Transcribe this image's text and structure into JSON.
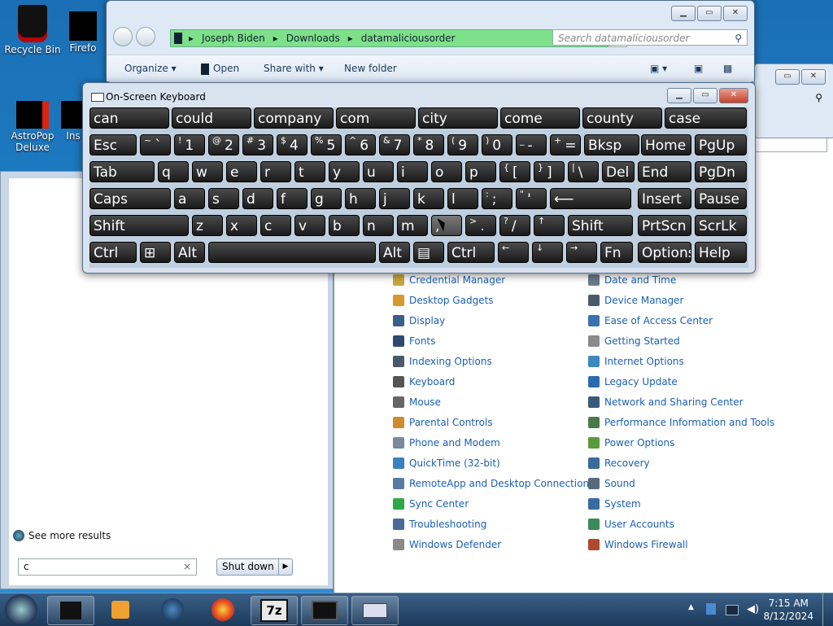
{
  "desktop": {
    "icons": [
      {
        "label": "Recycle Bin"
      },
      {
        "label": "Firefo"
      },
      {
        "label": "AstroPop Deluxe"
      },
      {
        "label": "Ins"
      }
    ]
  },
  "explorer": {
    "breadcrumb": [
      "Joseph Biden",
      "Downloads",
      "datamaliciousorder"
    ],
    "search_placeholder": "Search datamaliciousorder",
    "toolbar": {
      "organize": "Organize",
      "open": "Open",
      "share_with": "Share with",
      "new_folder": "New folder"
    }
  },
  "osk": {
    "title": "On-Screen Keyboard",
    "predictions": [
      "can",
      "could",
      "company",
      "com",
      "city",
      "come",
      "county",
      "case"
    ],
    "row1": [
      {
        "main": "Esc"
      },
      {
        "main": "` ",
        "sup": "~"
      },
      {
        "main": "1",
        "sup": "!"
      },
      {
        "main": "2",
        "sup": "@"
      },
      {
        "main": "3",
        "sup": "#"
      },
      {
        "main": "4",
        "sup": "$"
      },
      {
        "main": "5",
        "sup": "%"
      },
      {
        "main": "6",
        "sup": "^"
      },
      {
        "main": "7",
        "sup": "&"
      },
      {
        "main": "8",
        "sup": "*"
      },
      {
        "main": "9",
        "sup": "("
      },
      {
        "main": "0",
        "sup": ")"
      },
      {
        "main": "-",
        "sup": "_"
      },
      {
        "main": "=",
        "sup": "+"
      },
      {
        "main": "Bksp"
      },
      {
        "main": "Home"
      },
      {
        "main": "PgUp"
      }
    ],
    "row2": [
      {
        "main": "Tab"
      },
      {
        "main": "q"
      },
      {
        "main": "w"
      },
      {
        "main": "e"
      },
      {
        "main": "r"
      },
      {
        "main": "t"
      },
      {
        "main": "y"
      },
      {
        "main": "u"
      },
      {
        "main": "i"
      },
      {
        "main": "o"
      },
      {
        "main": "p"
      },
      {
        "main": "[",
        "sup": "{"
      },
      {
        "main": "]",
        "sup": "}"
      },
      {
        "main": "\\",
        "sup": "|"
      },
      {
        "main": "Del"
      },
      {
        "main": "End"
      },
      {
        "main": "PgDn"
      }
    ],
    "row3": [
      {
        "main": "Caps"
      },
      {
        "main": "a"
      },
      {
        "main": "s"
      },
      {
        "main": "d"
      },
      {
        "main": "f"
      },
      {
        "main": "g"
      },
      {
        "main": "h"
      },
      {
        "main": "j"
      },
      {
        "main": "k"
      },
      {
        "main": "l"
      },
      {
        "main": ";",
        "sup": ":"
      },
      {
        "main": "'",
        "sup": "\""
      },
      {
        "main": "⟵"
      },
      {
        "main": "Insert"
      },
      {
        "main": "Pause"
      }
    ],
    "row4": [
      {
        "main": "Shift"
      },
      {
        "main": "z"
      },
      {
        "main": "x"
      },
      {
        "main": "c"
      },
      {
        "main": "v"
      },
      {
        "main": "b"
      },
      {
        "main": "n"
      },
      {
        "main": "m"
      },
      {
        "main": ","
      },
      {
        "main": ".",
        "sup": ">"
      },
      {
        "main": "/",
        "sup": "?"
      },
      {
        "main": "",
        "sup": "↑"
      },
      {
        "main": "Shift"
      },
      {
        "main": "PrtScn"
      },
      {
        "main": "ScrLk"
      }
    ],
    "row5": [
      {
        "main": "Ctrl"
      },
      {
        "main": "⊞"
      },
      {
        "main": "Alt"
      },
      {
        "main": ""
      },
      {
        "main": "Alt"
      },
      {
        "main": "▤"
      },
      {
        "main": "Ctrl"
      },
      {
        "main": "",
        "sup": "←"
      },
      {
        "main": "",
        "sup": "↓"
      },
      {
        "main": "",
        "sup": "→"
      },
      {
        "main": "Fn"
      },
      {
        "main": "Options"
      },
      {
        "main": "Help"
      }
    ]
  },
  "start_menu": {
    "see_more": "See more results",
    "search_value": "c",
    "shutdown_label": "Shut down"
  },
  "control_panel": {
    "left_items": [
      {
        "label": "Credential Manager",
        "color": "#c9a640"
      },
      {
        "label": "Desktop Gadgets",
        "color": "#d59a2a"
      },
      {
        "label": "Display",
        "color": "#3a5f8a"
      },
      {
        "label": "Fonts",
        "color": "#2d4a6e"
      },
      {
        "label": "Indexing Options",
        "color": "#4a5a6a"
      },
      {
        "label": "Keyboard",
        "color": "#555555"
      },
      {
        "label": "Mouse",
        "color": "#666666"
      },
      {
        "label": "Parental Controls",
        "color": "#d08a30"
      },
      {
        "label": "Phone and Modem",
        "color": "#7a8a9a"
      },
      {
        "label": "QuickTime (32-bit)",
        "color": "#3a7fc0"
      },
      {
        "label": "RemoteApp and Desktop Connections",
        "color": "#5a7aa0"
      },
      {
        "label": "Sync Center",
        "color": "#2ea84a"
      },
      {
        "label": "Troubleshooting",
        "color": "#4a6a9a"
      },
      {
        "label": "Windows Defender",
        "color": "#8a8a8a"
      }
    ],
    "right_items": [
      {
        "label": "Date and Time",
        "color": "#6a7a8a"
      },
      {
        "label": "Device Manager",
        "color": "#4a5a6a"
      },
      {
        "label": "Ease of Access Center",
        "color": "#3a70b0"
      },
      {
        "label": "Getting Started",
        "color": "#8a8a8a"
      },
      {
        "label": "Internet Options",
        "color": "#3a8ac0"
      },
      {
        "label": "Legacy Update",
        "color": "#2a6ab0"
      },
      {
        "label": "Network and Sharing Center",
        "color": "#3a5a7a"
      },
      {
        "label": "Performance Information and Tools",
        "color": "#4a7a4a"
      },
      {
        "label": "Power Options",
        "color": "#5a9a3a"
      },
      {
        "label": "Recovery",
        "color": "#3a6a9a"
      },
      {
        "label": "Sound",
        "color": "#5a6a7a"
      },
      {
        "label": "System",
        "color": "#3a6aa0"
      },
      {
        "label": "User Accounts",
        "color": "#3a8a5a"
      },
      {
        "label": "Windows Firewall",
        "color": "#b04a2a"
      }
    ]
  },
  "taskbar": {
    "time": "7:15 AM",
    "date": "8/12/2024",
    "apps": [
      "start-orb",
      "explorer",
      "media-player",
      "globe",
      "firefox",
      "7z",
      "remote-desktop",
      "on-screen-keyboard"
    ],
    "sevenzip_label": "7z"
  }
}
